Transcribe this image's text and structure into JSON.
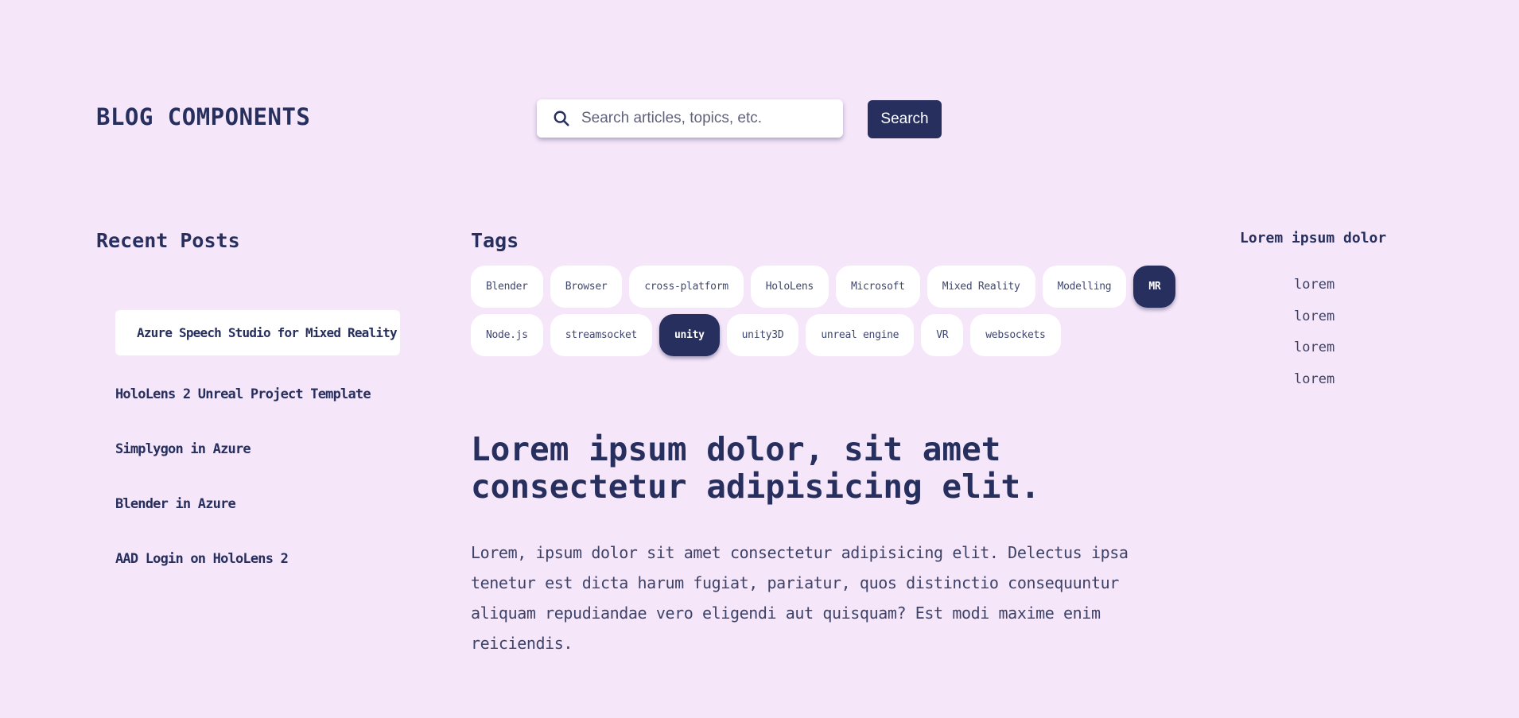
{
  "header": {
    "title": "BLOG COMPONENTS",
    "search_placeholder": "Search articles, topics, etc.",
    "search_button": "Search"
  },
  "recent_posts": {
    "heading": "Recent Posts",
    "items": [
      {
        "label": "Azure Speech Studio for Mixed Reality",
        "active": true
      },
      {
        "label": "HoloLens 2 Unreal Project Template",
        "active": false
      },
      {
        "label": "Simplygon in Azure",
        "active": false
      },
      {
        "label": "Blender in Azure",
        "active": false
      },
      {
        "label": "AAD Login on HoloLens 2",
        "active": false
      }
    ]
  },
  "tags": {
    "heading": "Tags",
    "row1": [
      {
        "label": "Blender",
        "selected": false
      },
      {
        "label": "Browser",
        "selected": false
      },
      {
        "label": "cross-platform",
        "selected": false
      },
      {
        "label": "HoloLens",
        "selected": false
      },
      {
        "label": "Microsoft",
        "selected": false
      },
      {
        "label": "Mixed Reality",
        "selected": false
      },
      {
        "label": "Modelling",
        "selected": false
      },
      {
        "label": "MR",
        "selected": true
      }
    ],
    "row2": [
      {
        "label": "Node.js",
        "selected": false
      },
      {
        "label": "streamsocket",
        "selected": false
      },
      {
        "label": "unity",
        "selected": true
      },
      {
        "label": "unity3D",
        "selected": false
      },
      {
        "label": "unreal engine",
        "selected": false
      },
      {
        "label": "VR",
        "selected": false
      },
      {
        "label": "websockets",
        "selected": false
      }
    ]
  },
  "article": {
    "title": "Lorem ipsum dolor, sit amet consectetur adipisicing elit.",
    "body": "Lorem, ipsum dolor sit amet consectetur adipisicing elit. Delectus ipsa tenetur est dicta harum fugiat, pariatur, quos distinctio consequuntur aliquam repudiandae vero eligendi aut quisquam? Est modi maxime enim reiciendis."
  },
  "sidebar": {
    "heading": "Lorem ipsum dolor",
    "items": [
      "lorem",
      "lorem",
      "lorem",
      "lorem"
    ]
  },
  "colors": {
    "background": "#f6e6f9",
    "primary": "#272f5e",
    "surface": "#ffffff"
  },
  "icons": {
    "search": "search-icon"
  }
}
